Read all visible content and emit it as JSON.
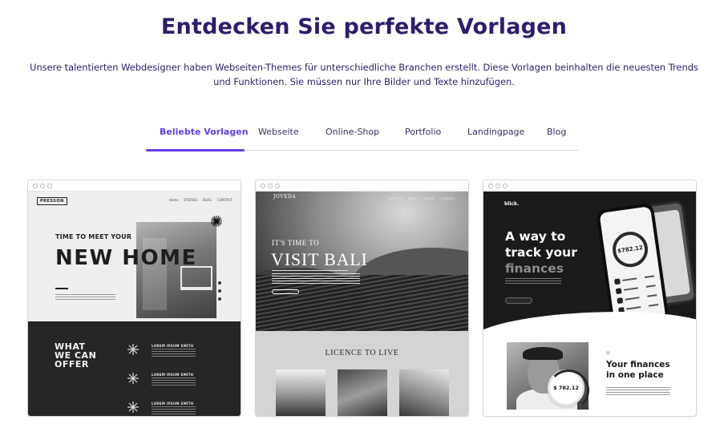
{
  "header": {
    "title": "Entdecken Sie perfekte Vorlagen",
    "subtitle": "Unsere talentierten Webdesigner haben Webseiten-Themes für unterschiedliche Branchen erstellt. Diese Vorlagen beinhalten die neuesten Trends und Funktionen. Sie müssen nur Ihre Bilder und Texte hinzufügen."
  },
  "tabs": [
    {
      "label": "Beliebte Vorlagen",
      "active": true
    },
    {
      "label": "Webseite",
      "active": false
    },
    {
      "label": "Online-Shop",
      "active": false
    },
    {
      "label": "Portfolio",
      "active": false
    },
    {
      "label": "Landingpage",
      "active": false
    },
    {
      "label": "Blog",
      "active": false
    }
  ],
  "accent_color": "#673de6",
  "heading_color": "#2f1c6a",
  "cards": [
    {
      "logo": "PRESSON",
      "nav": [
        "Home",
        "STORIES",
        "BLOG",
        "CONTACT"
      ],
      "kicker": "TIME TO MEET YOUR",
      "headline": "NEW HOME",
      "section_title": "WHAT\nWE CAN\nOFFER",
      "rows": [
        "LOREM IPSUM SMITH",
        "LOREM IPSUM SMITH",
        "LOREM IPSUM SMITH"
      ]
    },
    {
      "logo": "JOVEDA",
      "nav": [
        "ABOUT US",
        "BLOG",
        "TOURS",
        "CONTACT"
      ],
      "kicker": "IT'S TIME TO",
      "headline": "VISIT BALI",
      "section_title": "LICENCE TO LIVE"
    },
    {
      "logo": "blick.",
      "headline_1": "A way to",
      "headline_2": "track your",
      "headline_3": "finances",
      "amount": "$782.12",
      "small_amount": "$ 782.12",
      "number": "01",
      "section_title_1": "Your finances",
      "section_title_2": "in one place"
    }
  ]
}
